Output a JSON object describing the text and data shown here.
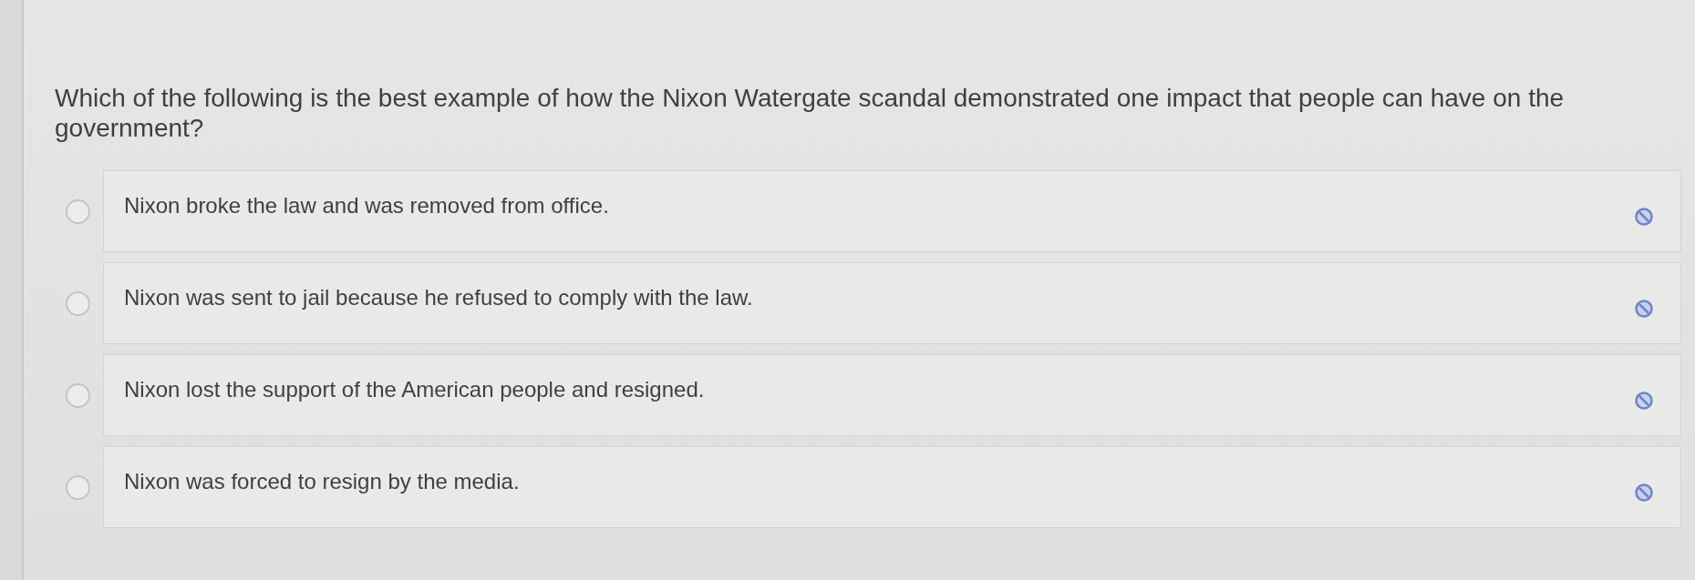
{
  "question": "Which of the following is the best example of how the Nixon Watergate scandal demonstrated one impact that people can have on the government?",
  "options": [
    {
      "text": "Nixon broke the law and was removed from office.",
      "selected": false
    },
    {
      "text": "Nixon was sent to jail because he refused to comply with the law.",
      "selected": false
    },
    {
      "text": "Nixon lost the support of the American people and resigned.",
      "selected": false
    },
    {
      "text": "Nixon was forced to resign by the media.",
      "selected": false
    }
  ]
}
